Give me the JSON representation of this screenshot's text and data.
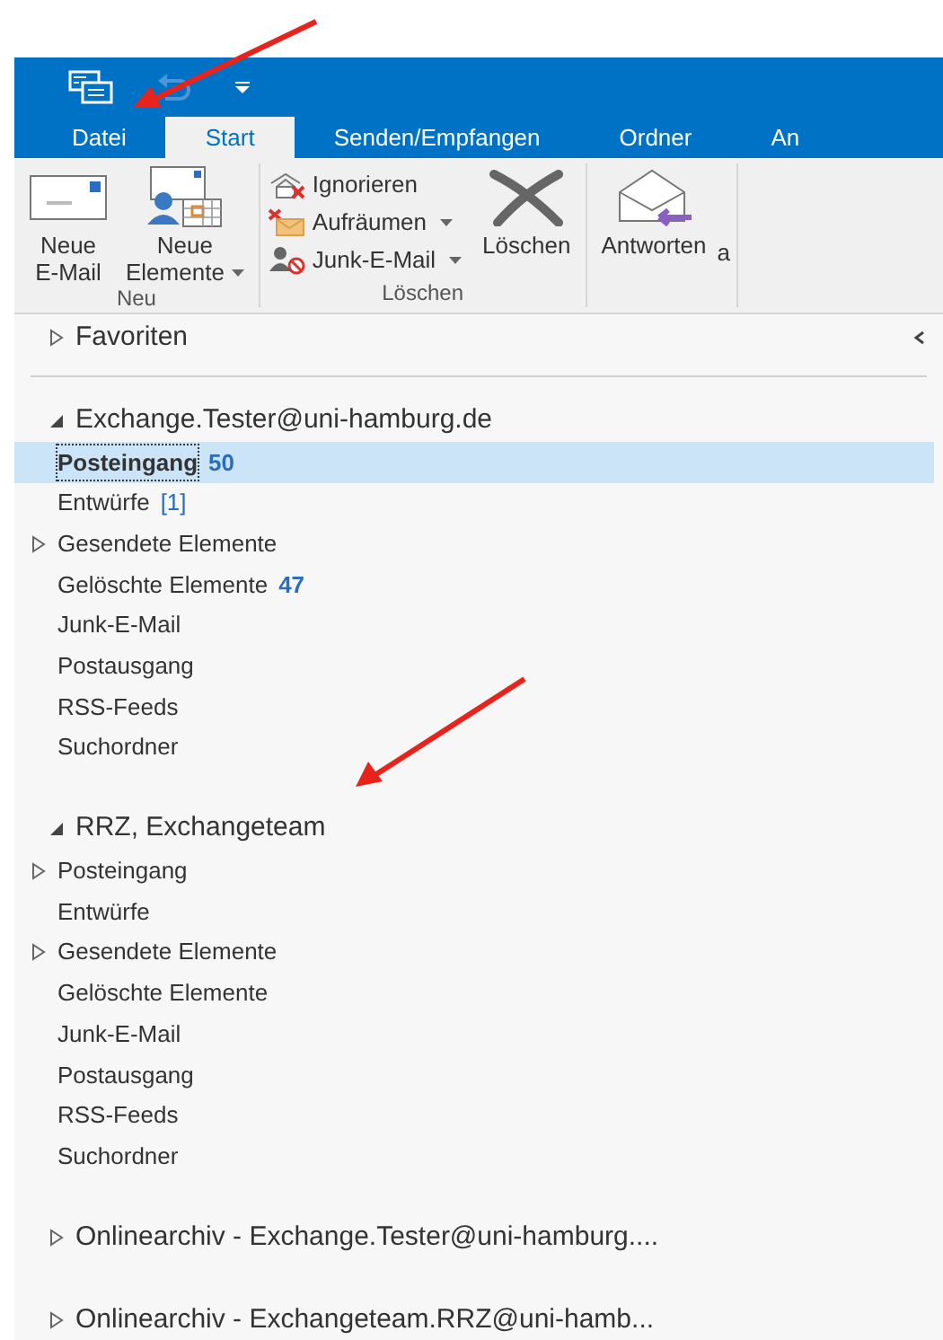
{
  "ribbon_tabs": [
    {
      "label": "Datei",
      "selected": false
    },
    {
      "label": "Start",
      "selected": true
    },
    {
      "label": "Senden/Empfangen",
      "selected": false
    },
    {
      "label": "Ordner",
      "selected": false
    },
    {
      "label": "An",
      "selected": false
    }
  ],
  "ribbon_groups": [
    {
      "label": "Neu",
      "buttons": [
        {
          "kind": "new-mail",
          "label": "Neue\nE-Mail",
          "dropdown": false
        },
        {
          "kind": "new-items",
          "label": "Neue\nElemente",
          "dropdown": true
        }
      ]
    },
    {
      "label": "Löschen",
      "small_buttons": [
        {
          "kind": "ignore",
          "label": "Ignorieren",
          "dropdown": false
        },
        {
          "kind": "cleanup",
          "label": "Aufräumen",
          "dropdown": true
        },
        {
          "kind": "junk",
          "label": "Junk-E-Mail",
          "dropdown": true
        }
      ],
      "buttons": [
        {
          "kind": "delete",
          "label": "Löschen",
          "dropdown": false
        }
      ]
    },
    {
      "buttons": [
        {
          "kind": "reply",
          "label": "Antworten",
          "dropdown": false
        }
      ],
      "cut_text": "a"
    }
  ],
  "favorites": {
    "label": "Favoriten",
    "expanded": false
  },
  "accounts": [
    {
      "name": "Exchange.Tester@uni-hamburg.de",
      "expanded": true,
      "children": [
        {
          "name": "Posteingang",
          "count": "50",
          "count_bold": true,
          "has_children": false,
          "selected": true
        },
        {
          "name": "Entwürfe",
          "count": "[1]",
          "count_bold": false,
          "has_children": false,
          "selected": false
        },
        {
          "name": "Gesendete Elemente",
          "has_children": true,
          "selected": false
        },
        {
          "name": "Gelöschte Elemente",
          "count": "47",
          "count_bold": true,
          "has_children": false,
          "selected": false
        },
        {
          "name": "Junk-E-Mail",
          "has_children": false,
          "selected": false
        },
        {
          "name": "Postausgang",
          "has_children": false,
          "selected": false
        },
        {
          "name": "RSS-Feeds",
          "has_children": false,
          "selected": false
        },
        {
          "name": "Suchordner",
          "has_children": false,
          "selected": false
        }
      ]
    },
    {
      "name": "RRZ, Exchangeteam",
      "expanded": true,
      "children": [
        {
          "name": "Posteingang",
          "has_children": true,
          "selected": false
        },
        {
          "name": "Entwürfe",
          "has_children": false,
          "selected": false
        },
        {
          "name": "Gesendete Elemente",
          "has_children": true,
          "selected": false
        },
        {
          "name": "Gelöschte Elemente",
          "has_children": false,
          "selected": false
        },
        {
          "name": "Junk-E-Mail",
          "has_children": false,
          "selected": false
        },
        {
          "name": "Postausgang",
          "has_children": false,
          "selected": false
        },
        {
          "name": "RSS-Feeds",
          "has_children": false,
          "selected": false
        },
        {
          "name": "Suchordner",
          "has_children": false,
          "selected": false
        }
      ]
    },
    {
      "name": "Onlinearchiv - Exchange.Tester@uni-hamburg....",
      "expanded": false
    },
    {
      "name": "Onlinearchiv - Exchangeteam.RRZ@uni-hamb...",
      "expanded": false
    }
  ]
}
